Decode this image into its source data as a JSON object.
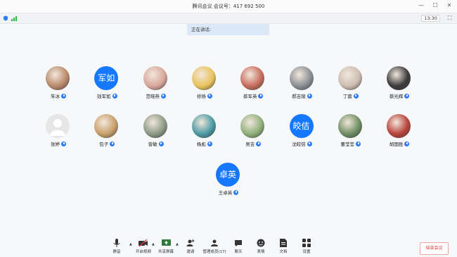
{
  "window": {
    "title": "腾讯会议 会议号：417 692 500"
  },
  "infobar": {
    "time": "13:30"
  },
  "speaking_label": "正在讲话:",
  "participants_row1": [
    {
      "name": "朱冰",
      "avatar": "photo",
      "color": "#b98a6a"
    },
    {
      "name": "钱军如",
      "avatar": "text",
      "text": "军如"
    },
    {
      "name": "范晓燕",
      "avatar": "photo",
      "color": "#d9a79b"
    },
    {
      "name": "修扬",
      "avatar": "photo",
      "color": "#e9c35c"
    },
    {
      "name": "蔡军英",
      "avatar": "photo",
      "color": "#c86d5d"
    },
    {
      "name": "郝吉陵",
      "avatar": "photo",
      "color": "#8a8f95"
    },
    {
      "name": "丁蓉",
      "avatar": "photo",
      "color": "#cdbdb2"
    },
    {
      "name": "蔡光辉",
      "avatar": "photo",
      "color": "#3b3a3c"
    }
  ],
  "participants_row2": [
    {
      "name": "张婷",
      "avatar": "default"
    },
    {
      "name": "包子",
      "avatar": "photo",
      "color": "#c8a06a"
    },
    {
      "name": "曾敏",
      "avatar": "photo",
      "color": "#8c9a86"
    },
    {
      "name": "杨彪",
      "avatar": "photo",
      "color": "#4a9aa4"
    },
    {
      "name": "吴吉",
      "avatar": "photo",
      "color": "#8fb07a"
    },
    {
      "name": "沈皎佶",
      "avatar": "text",
      "text": "皎佶"
    },
    {
      "name": "董莹莹",
      "avatar": "photo",
      "color": "#6e8e62"
    },
    {
      "name": "胡国胜",
      "avatar": "photo",
      "color": "#b8433c"
    }
  ],
  "participants_row3": [
    {
      "name": "王卓英",
      "avatar": "text",
      "text": "卓英"
    }
  ],
  "toolbar": {
    "mute": "静音",
    "video": "开启视频",
    "share": "共享屏幕",
    "invite": "邀请",
    "members": "管理成员(17)",
    "chat": "聊天",
    "reactions": "表情",
    "docs": "文档",
    "settings": "设置"
  },
  "end_button": "结束会议",
  "accent": "#1677ff"
}
